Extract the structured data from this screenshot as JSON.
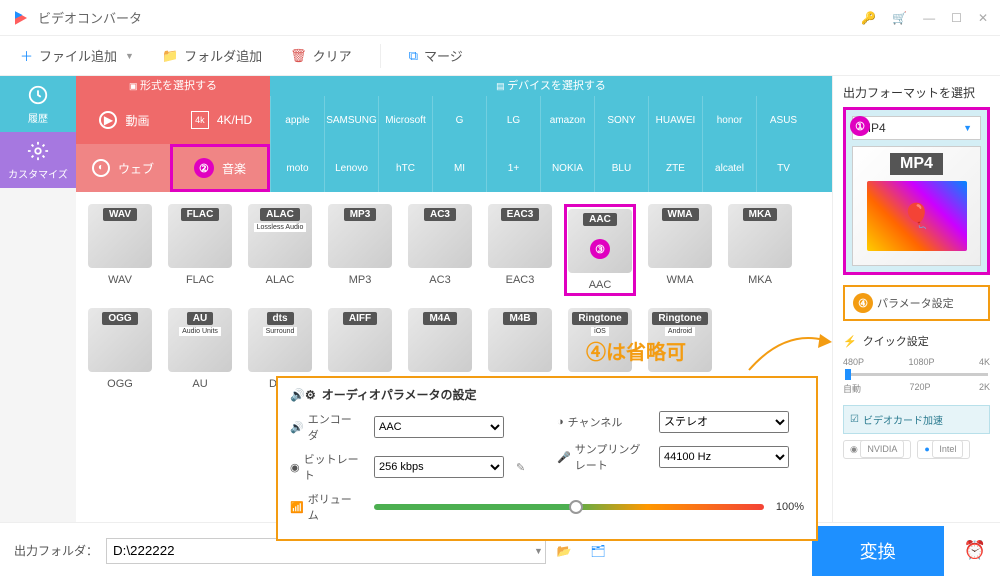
{
  "title": "ビデオコンバータ",
  "toolbar": {
    "add_file": "ファイル追加",
    "add_folder": "フォルダ追加",
    "clear": "クリア",
    "merge": "マージ"
  },
  "sidebar": {
    "history": "履歴",
    "customize": "カスタマイズ"
  },
  "tab_headers": {
    "format": "形式を選択する",
    "device": "デバイスを選択する"
  },
  "categories": {
    "video": "動画",
    "fourk": "4K/HD",
    "web": "ウェブ",
    "music": "音楽"
  },
  "brands": [
    "apple",
    "SAMSUNG",
    "Microsoft",
    "G",
    "LG",
    "amazon",
    "SONY",
    "HUAWEI",
    "honor",
    "ASUS",
    "moto",
    "Lenovo",
    "hTC",
    "MI",
    "1+",
    "NOKIA",
    "BLU",
    "ZTE",
    "alcatel",
    "TV"
  ],
  "formats": [
    {
      "name": "WAV",
      "tag": "WAV"
    },
    {
      "name": "FLAC",
      "tag": "FLAC"
    },
    {
      "name": "ALAC",
      "tag": "ALAC",
      "sub": "Lossless Audio"
    },
    {
      "name": "MP3",
      "tag": "MP3"
    },
    {
      "name": "AC3",
      "tag": "AC3"
    },
    {
      "name": "EAC3",
      "tag": "EAC3"
    },
    {
      "name": "AAC",
      "tag": "AAC",
      "highlight": true
    },
    {
      "name": "WMA",
      "tag": "WMA"
    },
    {
      "name": "MKA",
      "tag": "MKA"
    },
    {
      "name": "OGG",
      "tag": "OGG"
    },
    {
      "name": "AU",
      "tag": "AU",
      "sub": "Audio Units"
    },
    {
      "name": "DTS",
      "tag": "dts",
      "sub": "Surround"
    },
    {
      "name": "AIFF",
      "tag": "AIFF"
    },
    {
      "name": "M4A",
      "tag": "M4A"
    },
    {
      "name": "M4B",
      "tag": "M4B"
    },
    {
      "name": "Ringtone",
      "tag": "Ringtone",
      "sub": "iOS"
    },
    {
      "name": "Ringtone",
      "tag": "Ringtone",
      "sub": "Android"
    }
  ],
  "annotation_note": "④は省略可",
  "audio_params": {
    "title": "オーディオパラメータの設定",
    "encoder_label": "エンコーダ",
    "encoder_value": "AAC",
    "channel_label": "チャンネル",
    "channel_value": "ステレオ",
    "bitrate_label": "ビットレート",
    "bitrate_value": "256 kbps",
    "samplerate_label": "サンプリングレート",
    "samplerate_value": "44100 Hz",
    "volume_label": "ボリューム",
    "volume_value": "100%"
  },
  "right": {
    "output_format_title": "出力フォーマットを選択",
    "selected_format": "MP4",
    "param_btn": "パラメータ設定",
    "quick_title": "クイック設定",
    "resolutions_top": [
      "480P",
      "1080P",
      "4K"
    ],
    "resolutions_bottom": [
      "自動",
      "720P",
      "2K"
    ],
    "gpu_accel": "ビデオカード加速",
    "gpu_nvidia": "NVIDIA",
    "gpu_intel": "Intel"
  },
  "footer": {
    "output_label": "出力フォルダ：",
    "output_path": "D:\\222222",
    "convert": "変換"
  }
}
